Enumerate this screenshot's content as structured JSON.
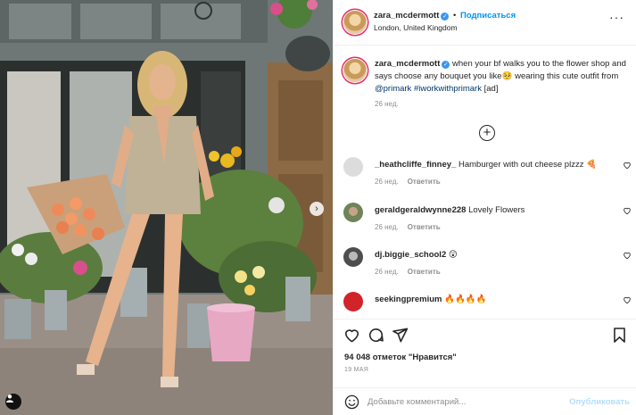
{
  "header": {
    "username": "zara_mcdermott",
    "separator": "•",
    "follow_label": "Подписаться",
    "location": "London, United Kingdom",
    "more_label": "···"
  },
  "caption": {
    "username": "zara_mcdermott",
    "text_before_emoji": "when your bf walks you to the flower shop and says choose any bouquet you like",
    "emoji": "🥺",
    "text_after_emoji": "wearing this cute outfit from",
    "mention": "@primark",
    "hashtag": "#iworkwithprimark",
    "tag": "[ad]",
    "time": "26 нед."
  },
  "load_more_label": "+",
  "comments": [
    {
      "username": "_heathcliffe_finney_",
      "text": "Hamburger with out cheese plzzz 🍕",
      "time": "26 нед.",
      "reply_label": "Ответить",
      "avatar_color": "#dcdcdc"
    },
    {
      "username": "geraldgeraldwynne228",
      "text": "Lovely Flowers",
      "time": "26 нед.",
      "reply_label": "Ответить",
      "avatar_color": "#7a8c6b"
    },
    {
      "username": "dj.biggie_school2",
      "text": "😲",
      "time": "26 нед.",
      "reply_label": "Ответить",
      "avatar_color": "#5e5e5e"
    },
    {
      "username": "seekingpremium",
      "text": "🔥🔥🔥🔥",
      "time": "",
      "reply_label": "",
      "avatar_color": "#d1232a"
    }
  ],
  "likes": "94 048 отметок \"Нравится\"",
  "date": "19 МАЯ",
  "add_comment": {
    "placeholder": "Добавьте комментарий...",
    "publish_label": "Опубликовать"
  },
  "next_label": "›",
  "colors": {
    "accent": "#0095f6",
    "verified": "#3897f0",
    "muted": "#8e8e8e",
    "border": "#efefef"
  }
}
